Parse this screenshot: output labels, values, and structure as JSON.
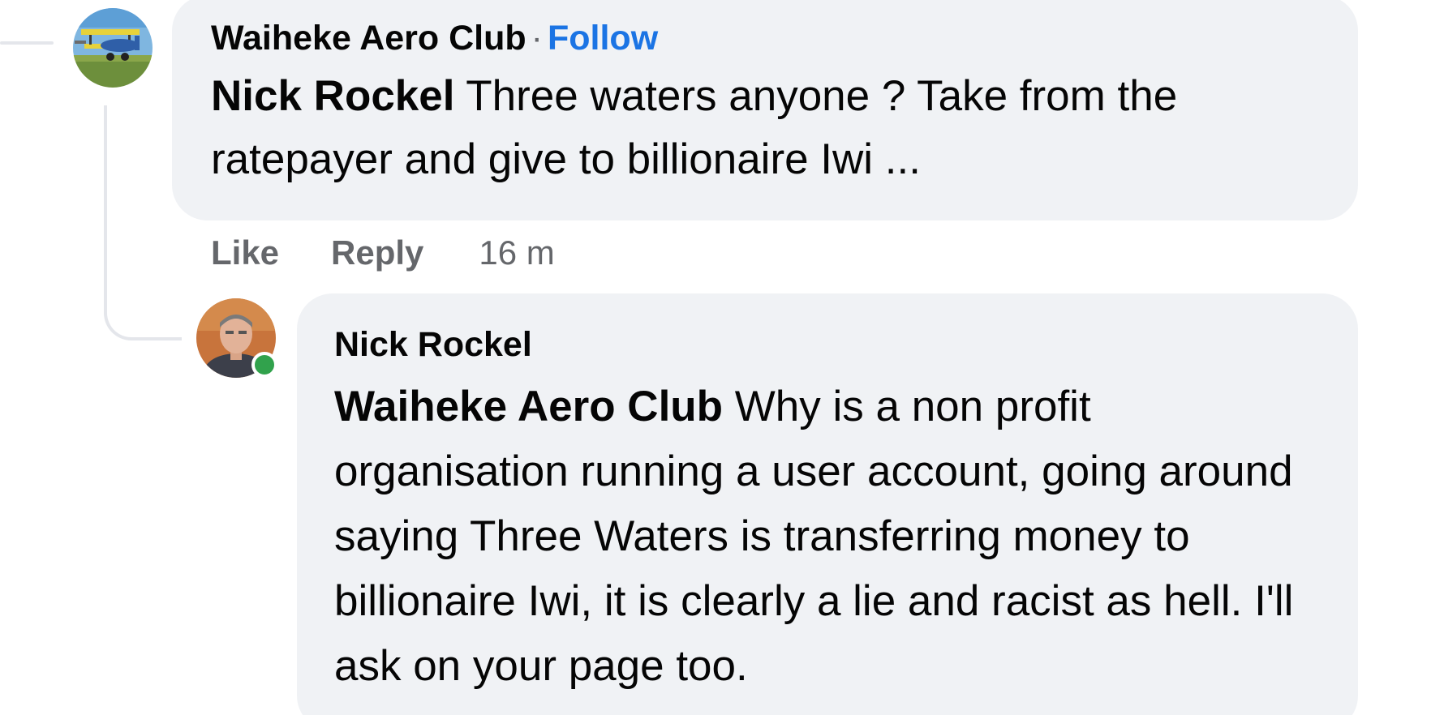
{
  "comment": {
    "author": "Waiheke Aero Club",
    "separator": "·",
    "follow_label": "Follow",
    "mention": "Nick Rockel",
    "text": " Three waters anyone ? Take from the ratepayer and give to billionaire Iwi ...",
    "actions": {
      "like_label": "Like",
      "reply_label": "Reply",
      "timestamp": "16 m"
    },
    "avatar_icon": "biplane-photo-avatar"
  },
  "reply": {
    "author": "Nick Rockel",
    "mention": "Waiheke Aero Club",
    "text": " Why is a non profit organisation running a user account, going around saying Three Waters is transferring money to billionaire Iwi, it is clearly a lie and racist as hell. I'll ask on your page too.",
    "avatar_icon": "person-photo-avatar",
    "online_status": "online"
  },
  "colors": {
    "bubble": "#f0f2f5",
    "link": "#1b74e4",
    "secondary_text": "#65676b",
    "online": "#31a24c",
    "thread_line": "#e4e6eb"
  }
}
